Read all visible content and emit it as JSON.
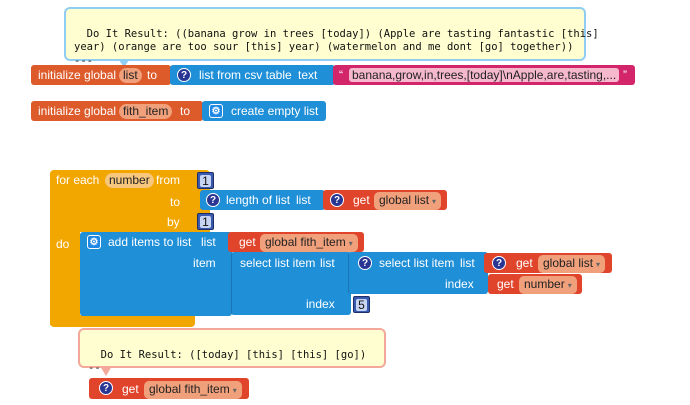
{
  "comments": {
    "top": "Do It Result: ((banana grow in trees [today]) (Apple are tasting fantastic [this]\nyear) (orange are too sour [this] year) (watermelon and me dont [go] together))\n---",
    "bottom": "Do It Result: ([today] [this] [this] [go])\n---"
  },
  "block_init_list": {
    "label": "initialize global",
    "var": "list",
    "to": "to",
    "fn": "list from csv table",
    "text": "text",
    "quote_l": "“",
    "value": "banana,grow,in,trees,[today]\\nApple,are,tasting,...",
    "quote_r": "”"
  },
  "block_init_fith": {
    "label": "initialize global",
    "var": "fith_item",
    "to": "to",
    "fn": "create empty list"
  },
  "for_each": {
    "for_each": "for each",
    "var": "number",
    "from": "from",
    "from_val": "1",
    "to": "to",
    "by": "by",
    "by_val": "1",
    "do": "do",
    "length_of_list": "length of list",
    "list_lbl": "list",
    "get": "get",
    "global_list": "global list"
  },
  "add_items": {
    "label": "add items to list",
    "list_lbl": "list",
    "item_lbl": "item",
    "get": "get",
    "target": "global fith_item",
    "select_list_item": "select list item",
    "select_list_lbl": "list",
    "index_lbl": "index",
    "index_val": "5",
    "inner_select": "select list item",
    "inner_list_lbl": "list",
    "inner_global": "global list",
    "inner_index_lbl": "index",
    "inner_number": "number"
  },
  "get_fith": {
    "get": "get",
    "var": "global fith_item"
  },
  "icons": {
    "question": "?",
    "gear": "⚙",
    "caret": "▾"
  }
}
